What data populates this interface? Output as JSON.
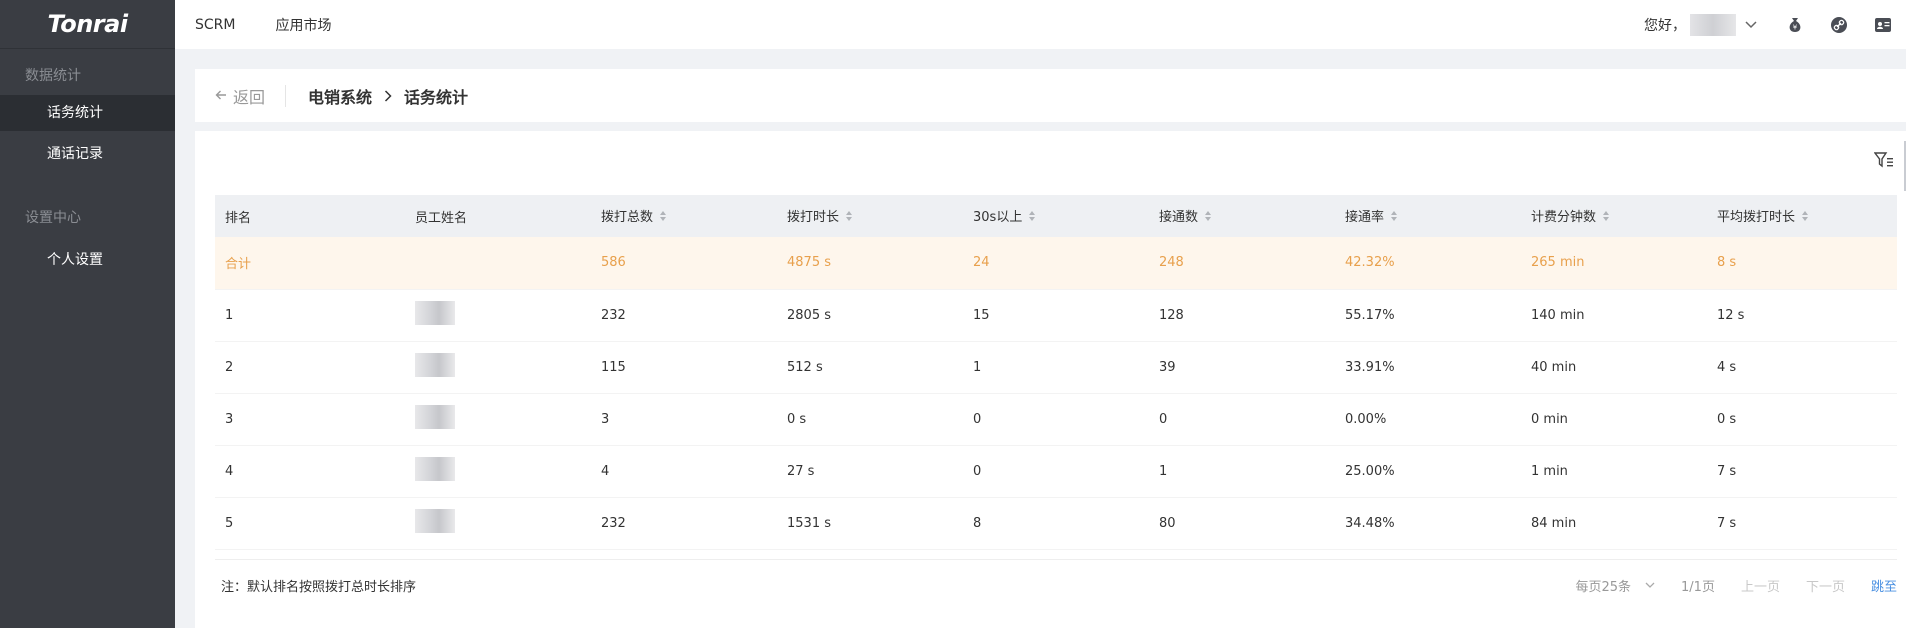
{
  "sidebar": {
    "logo": "Tonrai",
    "sections": [
      {
        "title": "数据统计",
        "items": [
          {
            "label": "话务统计",
            "active": true
          },
          {
            "label": "通话记录",
            "active": false
          }
        ]
      },
      {
        "title": "设置中心",
        "items": [
          {
            "label": "个人设置",
            "active": false
          }
        ]
      }
    ]
  },
  "topbar": {
    "links": [
      "SCRM",
      "应用市场"
    ],
    "greeting": "您好，",
    "icons": [
      "money-bag-icon",
      "link-icon",
      "contact-card-icon"
    ]
  },
  "breadcrumb": {
    "back_label": "返回",
    "parent": "电销系统",
    "current": "话务统计"
  },
  "table": {
    "columns": [
      "排名",
      "员工姓名",
      "拨打总数",
      "拨打时长",
      "30s以上",
      "接通数",
      "接通率",
      "计费分钟数",
      "平均拨打时长"
    ],
    "sortable": [
      false,
      false,
      true,
      true,
      true,
      true,
      true,
      true,
      true
    ],
    "total_row": [
      "合计",
      "",
      "586",
      "4875 s",
      "24",
      "248",
      "42.32%",
      "265 min",
      "8 s"
    ],
    "rows": [
      [
        "1",
        "",
        "232",
        "2805 s",
        "15",
        "128",
        "55.17%",
        "140 min",
        "12 s"
      ],
      [
        "2",
        "",
        "115",
        "512 s",
        "1",
        "39",
        "33.91%",
        "40 min",
        "4 s"
      ],
      [
        "3",
        "",
        "3",
        "0 s",
        "0",
        "0",
        "0.00%",
        "0 min",
        "0 s"
      ],
      [
        "4",
        "",
        "4",
        "27 s",
        "0",
        "1",
        "25.00%",
        "1 min",
        "7 s"
      ],
      [
        "5",
        "",
        "232",
        "1531 s",
        "8",
        "80",
        "34.48%",
        "84 min",
        "7 s"
      ]
    ]
  },
  "footer": {
    "note": "注：默认排名按照拨打总时长排序",
    "page_size": "每页25条",
    "page_info": "1/1页",
    "prev": "上一页",
    "next": "下一页",
    "jump": "跳至"
  },
  "colors": {
    "sidebar_bg": "#3a3d43",
    "total_row_bg": "#fef6ec",
    "total_row_text": "#e8a04c",
    "link_blue": "#4a90e2"
  }
}
